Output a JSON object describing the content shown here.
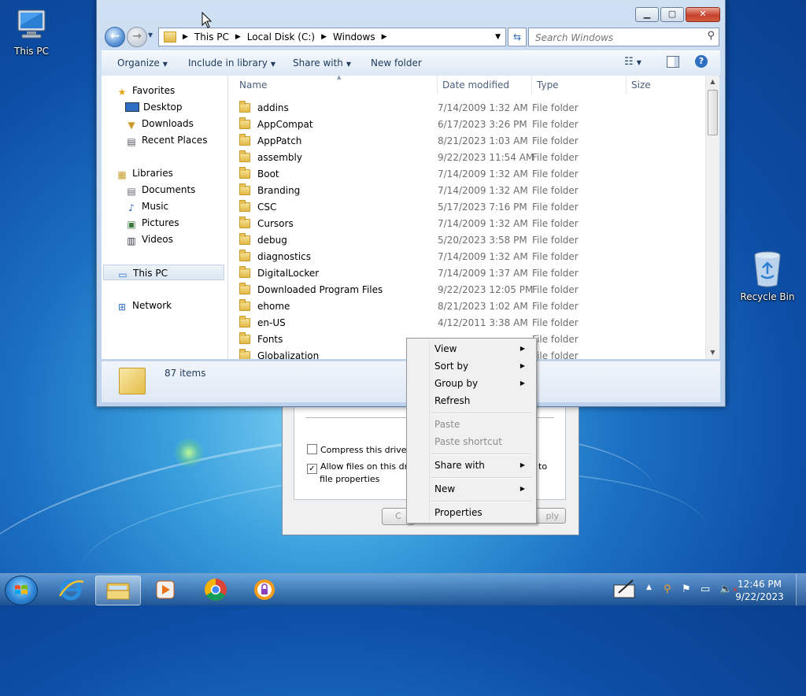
{
  "desktop": {
    "this_pc_label": "This PC",
    "recycle_bin_label": "Recycle Bin"
  },
  "explorer": {
    "address": [
      "This PC",
      "Local Disk (C:)",
      "Windows"
    ],
    "search_placeholder": "Search Windows",
    "toolbar": {
      "organize": "Organize",
      "include_in_library": "Include in library",
      "share_with": "Share with",
      "new_folder": "New folder"
    },
    "nav": {
      "favorites": "Favorites",
      "desktop": "Desktop",
      "downloads": "Downloads",
      "recent_places": "Recent Places",
      "libraries": "Libraries",
      "documents": "Documents",
      "music": "Music",
      "pictures": "Pictures",
      "videos": "Videos",
      "this_pc": "This PC",
      "network": "Network"
    },
    "columns": {
      "name": "Name",
      "date_modified": "Date modified",
      "type": "Type",
      "size": "Size"
    },
    "files": [
      {
        "name": "addins",
        "date": "7/14/2009 1:32 AM",
        "type": "File folder"
      },
      {
        "name": "AppCompat",
        "date": "6/17/2023 3:26 PM",
        "type": "File folder"
      },
      {
        "name": "AppPatch",
        "date": "8/21/2023 1:03 AM",
        "type": "File folder"
      },
      {
        "name": "assembly",
        "date": "9/22/2023 11:54 AM",
        "type": "File folder"
      },
      {
        "name": "Boot",
        "date": "7/14/2009 1:32 AM",
        "type": "File folder"
      },
      {
        "name": "Branding",
        "date": "7/14/2009 1:32 AM",
        "type": "File folder"
      },
      {
        "name": "CSC",
        "date": "5/17/2023 7:16 PM",
        "type": "File folder"
      },
      {
        "name": "Cursors",
        "date": "7/14/2009 1:32 AM",
        "type": "File folder"
      },
      {
        "name": "debug",
        "date": "5/20/2023 3:58 PM",
        "type": "File folder"
      },
      {
        "name": "diagnostics",
        "date": "7/14/2009 1:32 AM",
        "type": "File folder"
      },
      {
        "name": "DigitalLocker",
        "date": "7/14/2009 1:37 AM",
        "type": "File folder"
      },
      {
        "name": "Downloaded Program Files",
        "date": "9/22/2023 12:05 PM",
        "type": "File folder"
      },
      {
        "name": "ehome",
        "date": "8/21/2023 1:02 AM",
        "type": "File folder"
      },
      {
        "name": "en-US",
        "date": "4/12/2011 3:38 AM",
        "type": "File folder"
      },
      {
        "name": "Fonts",
        "date": "",
        "type": "File folder"
      },
      {
        "name": "Globalization",
        "date": "",
        "type": "File folder"
      }
    ],
    "status": {
      "item_count": "87 items"
    }
  },
  "context_menu": {
    "view": "View",
    "sort_by": "Sort by",
    "group_by": "Group by",
    "refresh": "Refresh",
    "paste": "Paste",
    "paste_shortcut": "Paste shortcut",
    "share_with": "Share with",
    "new": "New",
    "properties": "Properties"
  },
  "properties_dialog": {
    "compress_label": "Compress this drive to sa",
    "index_label_line1": "Allow files on this drive to",
    "index_label_tail": "to",
    "index_label_line2": "file properties",
    "ok_label": "C",
    "apply_label": "ply"
  },
  "taskbar": {
    "time": "12:46 PM",
    "date": "9/22/2023"
  }
}
